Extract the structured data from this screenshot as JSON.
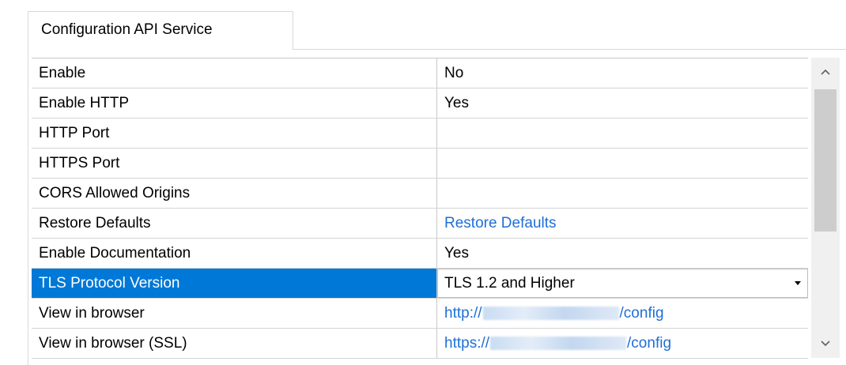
{
  "tab": {
    "label": "Configuration API Service"
  },
  "properties": [
    {
      "name": "Enable",
      "value": "No"
    },
    {
      "name": "Enable HTTP",
      "value": "Yes"
    },
    {
      "name": "HTTP Port",
      "value": ""
    },
    {
      "name": "HTTPS Port",
      "value": ""
    },
    {
      "name": "CORS Allowed Origins",
      "value": ""
    },
    {
      "name": "Restore Defaults",
      "value": "Restore Defaults"
    },
    {
      "name": "Enable Documentation",
      "value": "Yes"
    },
    {
      "name": "TLS Protocol Version",
      "value": "TLS 1.2 and Higher"
    },
    {
      "name": "View in browser",
      "value_prefix": "http://",
      "value_suffix": "/config"
    },
    {
      "name": "View in browser (SSL)",
      "value_prefix": "https://",
      "value_suffix": "/config"
    }
  ],
  "scrollbar": {
    "up_icon": "chevron-up-icon",
    "down_icon": "chevron-down-icon"
  },
  "colors": {
    "selection": "#0078d7",
    "link": "#1e6fd6"
  }
}
